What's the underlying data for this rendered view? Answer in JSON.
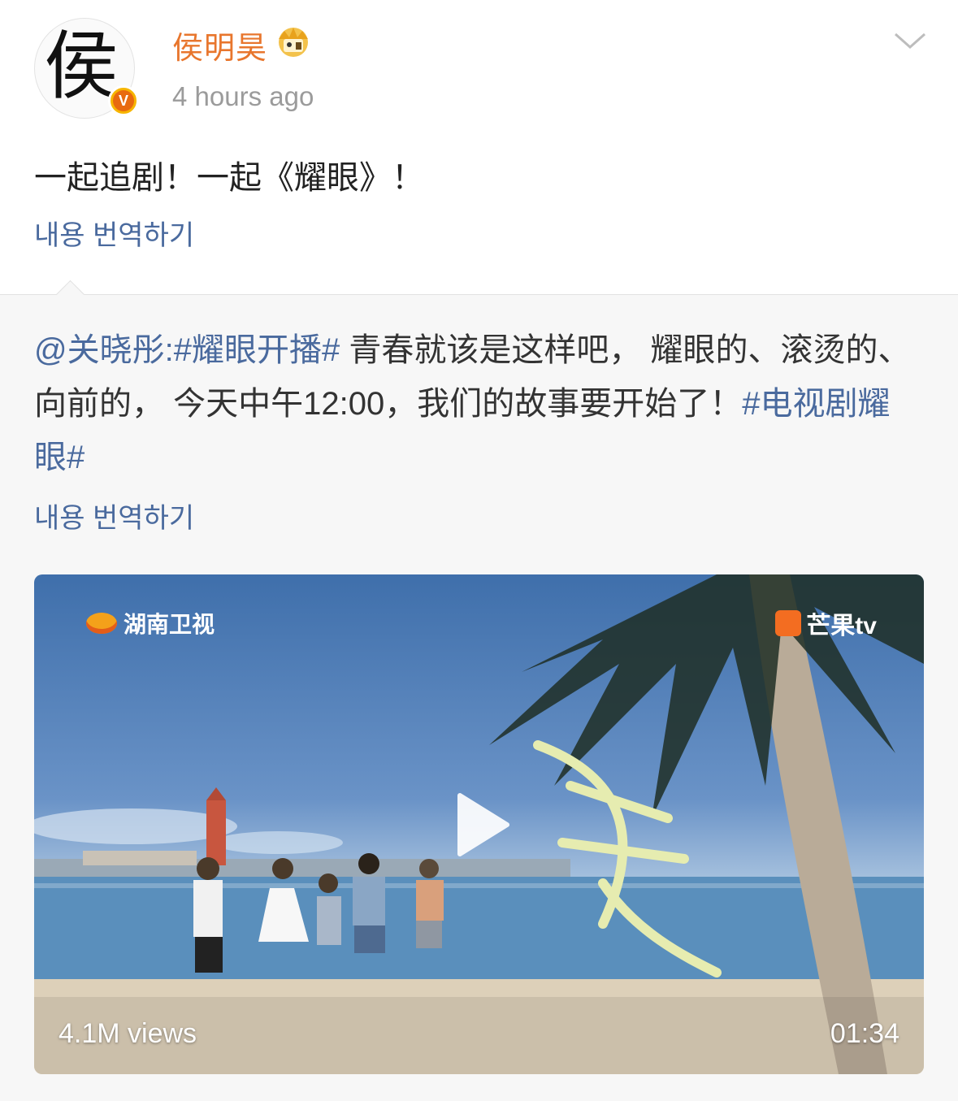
{
  "post": {
    "avatar_glyph": "侯",
    "username": "侯明昊",
    "timestamp": "4 hours ago",
    "text": "一起追剧！一起《耀眼》！",
    "translate_label": "내용 번역하기",
    "badge_icon": "verified-v-icon",
    "crown_icon": "crown-icon",
    "menu_icon": "chevron-down-icon"
  },
  "repost": {
    "mention": "@关晓彤",
    "separator": ":",
    "hashtag1": "#耀眼开播#",
    "body": " 青春就该是这样吧， 耀眼的、滚烫的、向前的， 今天中午12:00，我们的故事要开始了！",
    "hashtag2": "#电视剧耀眼#",
    "translate_label": "내용 번역하기"
  },
  "video": {
    "channel_logo": "湖南卫视",
    "platform_logo": "芒果tv",
    "views": "4.1M views",
    "duration": "01:34",
    "play_icon": "play-icon"
  },
  "colors": {
    "username": "#e8762d",
    "link": "#4a6a9e",
    "repost_bg": "#f7f7f7"
  }
}
